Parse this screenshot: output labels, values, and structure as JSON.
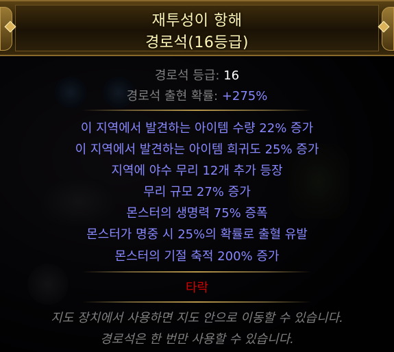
{
  "header": {
    "name": "재투성이 항해",
    "base_type": "경로석(16등급)"
  },
  "properties": [
    {
      "label": "경로석 등급:",
      "value": "16",
      "augmented": false
    },
    {
      "label": "경로석 출현 확률:",
      "value": "+275%",
      "augmented": true
    }
  ],
  "mods": [
    "이 지역에서 발견하는 아이템 수량 22% 증가",
    "이 지역에서 발견하는 아이템 희귀도 25% 증가",
    "지역에 야수 무리 12개 추가 등장",
    "무리 규모 27% 증가",
    "몬스터의 생명력 75% 증폭",
    "몬스터가 명중 시 25%의 확률로 출혈 유발",
    "몬스터의 기절 축적 200% 증가"
  ],
  "corrupted_label": "타락",
  "flavour": [
    "지도 장치에서 사용하면 지도 안으로 이동할 수 있습니다.",
    "경로석은 한 번만 사용할 수 있습니다."
  ],
  "colors": {
    "header_text": "#fff6b8",
    "property_label": "#7f7f7f",
    "property_value": "#ffffff",
    "magic_mod": "#8888ff",
    "corrupted": "#d20000",
    "flavour": "#7f7f7f",
    "border_gold": "#8a6a2c"
  }
}
